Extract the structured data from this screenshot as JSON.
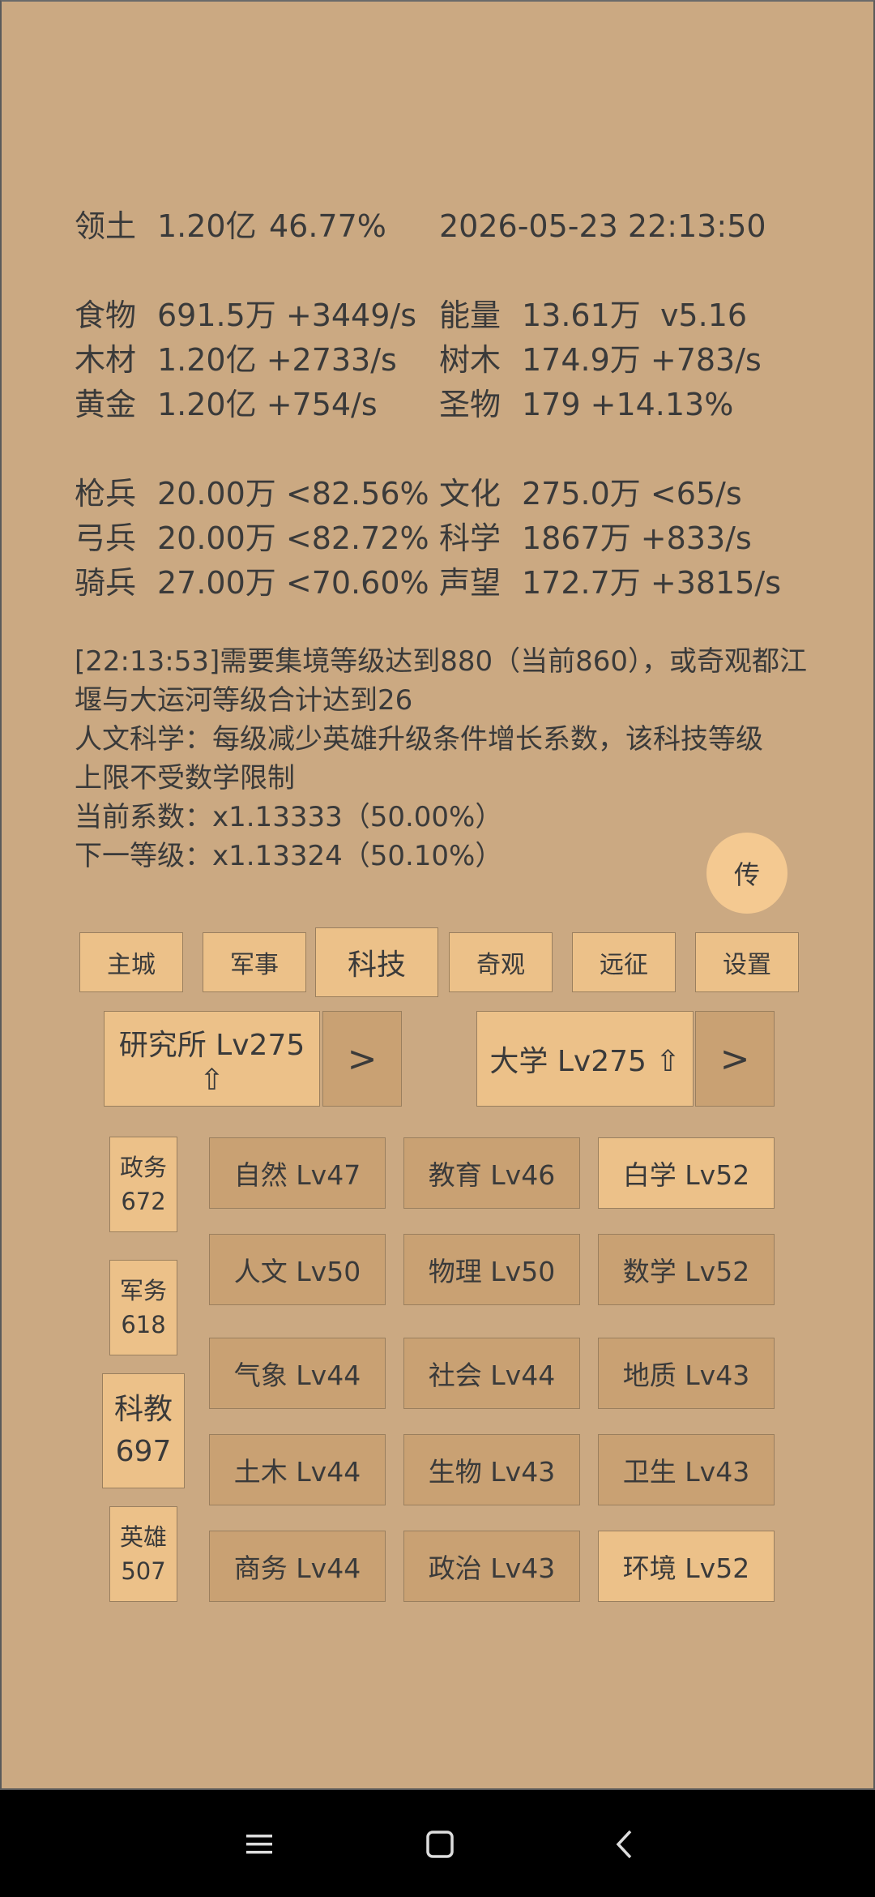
{
  "stats": {
    "territory": {
      "label": "领土",
      "value": "1.20亿",
      "extra": "46.77%"
    },
    "datetime": "2026-05-23 22:13:50",
    "left": [
      {
        "label": "食物",
        "value": "691.5万 +3449/s"
      },
      {
        "label": "木材",
        "value": "1.20亿 +2733/s"
      },
      {
        "label": "黄金",
        "value": "1.20亿 +754/s"
      },
      {
        "label": "枪兵",
        "value": "20.00万 <82.56%"
      },
      {
        "label": "弓兵",
        "value": "20.00万 <82.72%"
      },
      {
        "label": "骑兵",
        "value": "27.00万 <70.60%"
      }
    ],
    "right": [
      {
        "label": "能量",
        "value": "13.61万  v5.16"
      },
      {
        "label": "树木",
        "value": "174.9万 +783/s"
      },
      {
        "label": "圣物",
        "value": "179 +14.13%"
      },
      {
        "label": "文化",
        "value": "275.0万 <65/s"
      },
      {
        "label": "科学",
        "value": "1867万 +833/s"
      },
      {
        "label": "声望",
        "value": "172.7万 +3815/s"
      }
    ]
  },
  "message": [
    "[22:13:53]需要集境等级达到880（当前860），或奇观都江",
    "堰与大运河等级合计达到26",
    "人文科学：每级减少英雄升级条件增长系数，该科技等级",
    "上限不受数学限制",
    "当前系数：x1.13333（50.00%）",
    "下一等级：x1.13324（50.10%）"
  ],
  "fab_label": "传",
  "tabs": [
    "主城",
    "军事",
    "科技",
    "奇观",
    "远征",
    "设置"
  ],
  "active_tab": 2,
  "buildings": {
    "left": {
      "label": "研究所 Lv275 ⇧",
      "arrow": ">"
    },
    "right": {
      "label": "大学 Lv275 ⇧",
      "arrow": ">"
    }
  },
  "categories": [
    {
      "name": "政务",
      "count": "672"
    },
    {
      "name": "军务",
      "count": "618"
    },
    {
      "name": "科教",
      "count": "697"
    },
    {
      "name": "英雄",
      "count": "507"
    }
  ],
  "techs": [
    [
      "自然 Lv47",
      "教育 Lv46",
      "白学 Lv52"
    ],
    [
      "人文 Lv50",
      "物理 Lv50",
      "数学 Lv52"
    ],
    [
      "气象 Lv44",
      "社会 Lv44",
      "地质 Lv43"
    ],
    [
      "土木 Lv44",
      "生物 Lv43",
      "卫生 Lv43"
    ],
    [
      "商务 Lv44",
      "政治 Lv43",
      "环境 Lv52"
    ]
  ],
  "colors": {
    "background": "#cba982",
    "button_light": "#ecc189",
    "button_dark": "#c9a173",
    "fab": "#f4c991"
  },
  "icons": {
    "nav_menu": "menu-icon",
    "nav_home": "home-icon",
    "nav_back": "back-icon"
  }
}
